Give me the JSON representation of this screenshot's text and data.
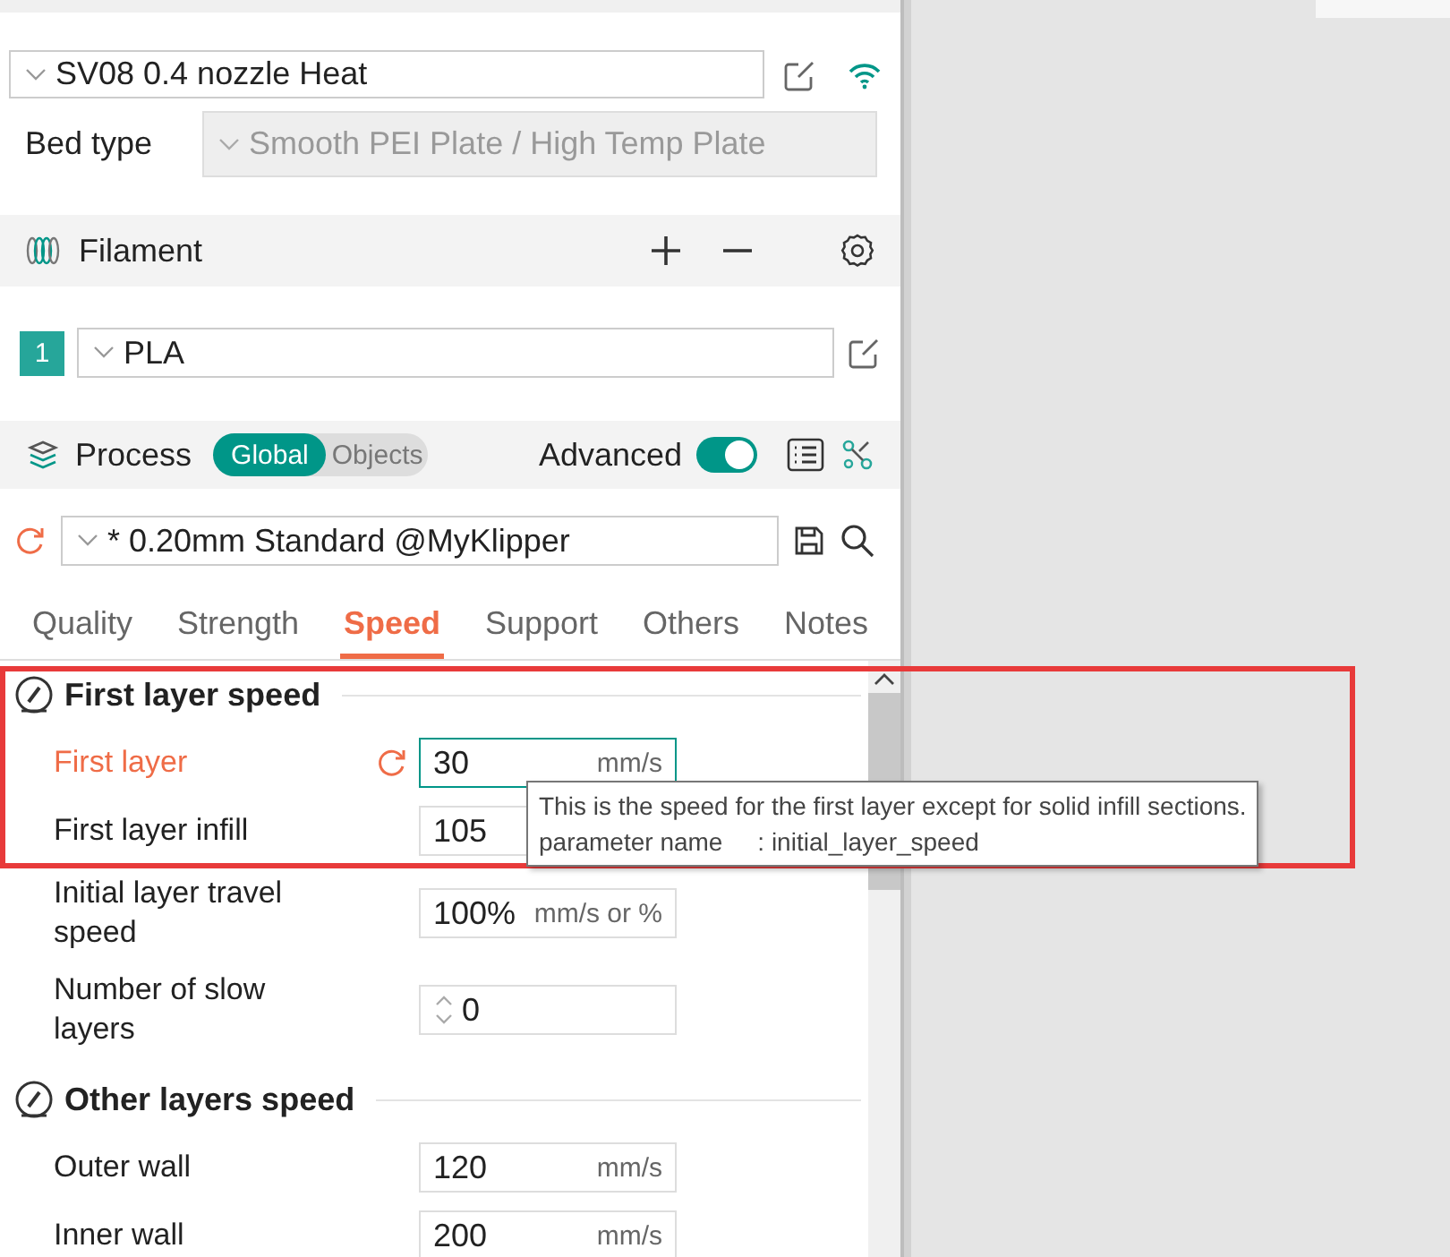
{
  "printer": {
    "preset": "SV08 0.4 nozzle Heat",
    "connected": true
  },
  "bed_type": {
    "label": "Bed type",
    "value": "Smooth PEI Plate / High Temp Plate",
    "disabled": true
  },
  "filament": {
    "title": "Filament",
    "slots": [
      {
        "index": "1",
        "color": "#26a69a",
        "value": "PLA"
      }
    ]
  },
  "process": {
    "title": "Process",
    "modes": [
      {
        "label": "Global",
        "selected": true
      },
      {
        "label": "Objects",
        "selected": false
      }
    ],
    "advanced_label": "Advanced",
    "advanced_on": true,
    "preset": "* 0.20mm Standard @MyKlipper",
    "modified": true
  },
  "tabs": [
    {
      "label": "Quality",
      "selected": false
    },
    {
      "label": "Strength",
      "selected": false
    },
    {
      "label": "Speed",
      "selected": true
    },
    {
      "label": "Support",
      "selected": false
    },
    {
      "label": "Others",
      "selected": false
    },
    {
      "label": "Notes",
      "selected": false
    }
  ],
  "sections": [
    {
      "title": "First layer speed",
      "rows": [
        {
          "kind": "number",
          "label": "First layer",
          "value": "30",
          "unit": "mm/s",
          "modified": true,
          "focused": true
        },
        {
          "kind": "number",
          "label": "First layer infill",
          "value": "105",
          "unit": "",
          "modified": false,
          "focused": false
        },
        {
          "kind": "number",
          "label": "Initial layer travel speed",
          "value": "100%",
          "unit": "mm/s or %",
          "modified": false,
          "focused": false
        },
        {
          "kind": "spin",
          "label": "Number of slow layers",
          "value": "0",
          "unit": "",
          "modified": false,
          "focused": false
        }
      ]
    },
    {
      "title": "Other layers speed",
      "rows": [
        {
          "kind": "number",
          "label": "Outer wall",
          "value": "120",
          "unit": "mm/s",
          "modified": false,
          "focused": false
        },
        {
          "kind": "number",
          "label": "Inner wall",
          "value": "200",
          "unit": "mm/s",
          "modified": false,
          "focused": false
        }
      ]
    }
  ],
  "tooltip": {
    "lines": [
      "This is the speed for the first layer except for solid infill sections.",
      "parameter name     : initial_layer_speed"
    ]
  },
  "annotation": {
    "kind": "highlight"
  }
}
